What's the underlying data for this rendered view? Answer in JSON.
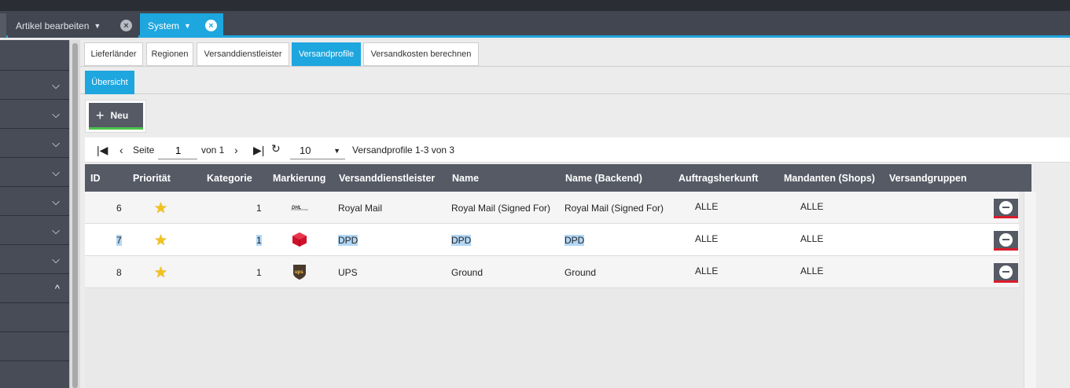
{
  "tabs": [
    {
      "label": "Artikel bearbeiten",
      "active": false
    },
    {
      "label": "System",
      "active": true
    }
  ],
  "subtabs": [
    "Lieferländer",
    "Regionen",
    "Versanddienstleister",
    "Versandprofile",
    "Versandkosten berechnen"
  ],
  "active_subtab": "Versandprofile",
  "section_tab": "Übersicht",
  "new_button": "Neu",
  "pager": {
    "page_label": "Seite",
    "page_value": "1",
    "of_label": "von 1",
    "per_page": "10",
    "range_text": "Versandprofile  1-3 von 3"
  },
  "columns": [
    "ID",
    "Priorität",
    "Kategorie",
    "Markierung",
    "Versanddienstleister",
    "Name",
    "Name (Backend)",
    "Auftragsherkunft",
    "Mandanten (Shops)",
    "Versandgruppen"
  ],
  "rows": [
    {
      "id": "6",
      "category": "1",
      "mark_icon": "dhl-logo",
      "provider": "Royal Mail",
      "name": "Royal Mail (Signed For)",
      "backend": "Royal Mail (Signed For)",
      "origin": "ALLE",
      "clients": "ALLE",
      "groups": ""
    },
    {
      "id": "7",
      "category": "1",
      "mark_icon": "dpd-logo",
      "provider": "DPD",
      "name": "DPD",
      "backend": "DPD",
      "origin": "ALLE",
      "clients": "ALLE",
      "groups": ""
    },
    {
      "id": "8",
      "category": "1",
      "mark_icon": "ups-logo",
      "provider": "UPS",
      "name": "Ground",
      "backend": "Ground",
      "origin": "ALLE",
      "clients": "ALLE",
      "groups": ""
    }
  ],
  "colors": {
    "accent": "#1ea6df",
    "header_bg": "#555a65",
    "delete_accent": "#d91c2a",
    "new_accent": "#4cc24c",
    "star": "#f2c21f"
  }
}
